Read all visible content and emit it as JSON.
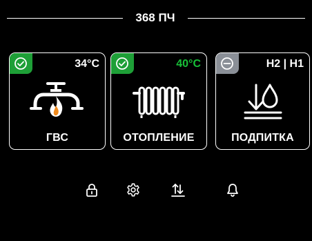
{
  "header": {
    "title": "368 ПЧ"
  },
  "cards": [
    {
      "status": "ok",
      "status_icon": "check-circle-icon",
      "value": "34°C",
      "icon": "faucet-flame-icon",
      "label": "ГВС"
    },
    {
      "status": "ok",
      "status_icon": "check-circle-icon",
      "value": "40°C",
      "value_color": "#18c038",
      "icon": "radiator-icon",
      "label": "ОТОПЛЕНИЕ"
    },
    {
      "status": "off",
      "status_icon": "minus-circle-icon",
      "value": "H2 | H1",
      "icon": "water-fill-icon",
      "label": "ПОДПИТКА"
    }
  ],
  "toolbar": [
    {
      "icon": "lock-icon"
    },
    {
      "icon": "gear-icon"
    },
    {
      "icon": "sort-arrows-icon"
    },
    {
      "icon": "bell-icon"
    }
  ],
  "colors": {
    "background": "#000000",
    "status_ok": "#1e9f37",
    "status_off": "#8a8f97",
    "accent_green": "#18c038",
    "foreground": "#ffffff"
  }
}
